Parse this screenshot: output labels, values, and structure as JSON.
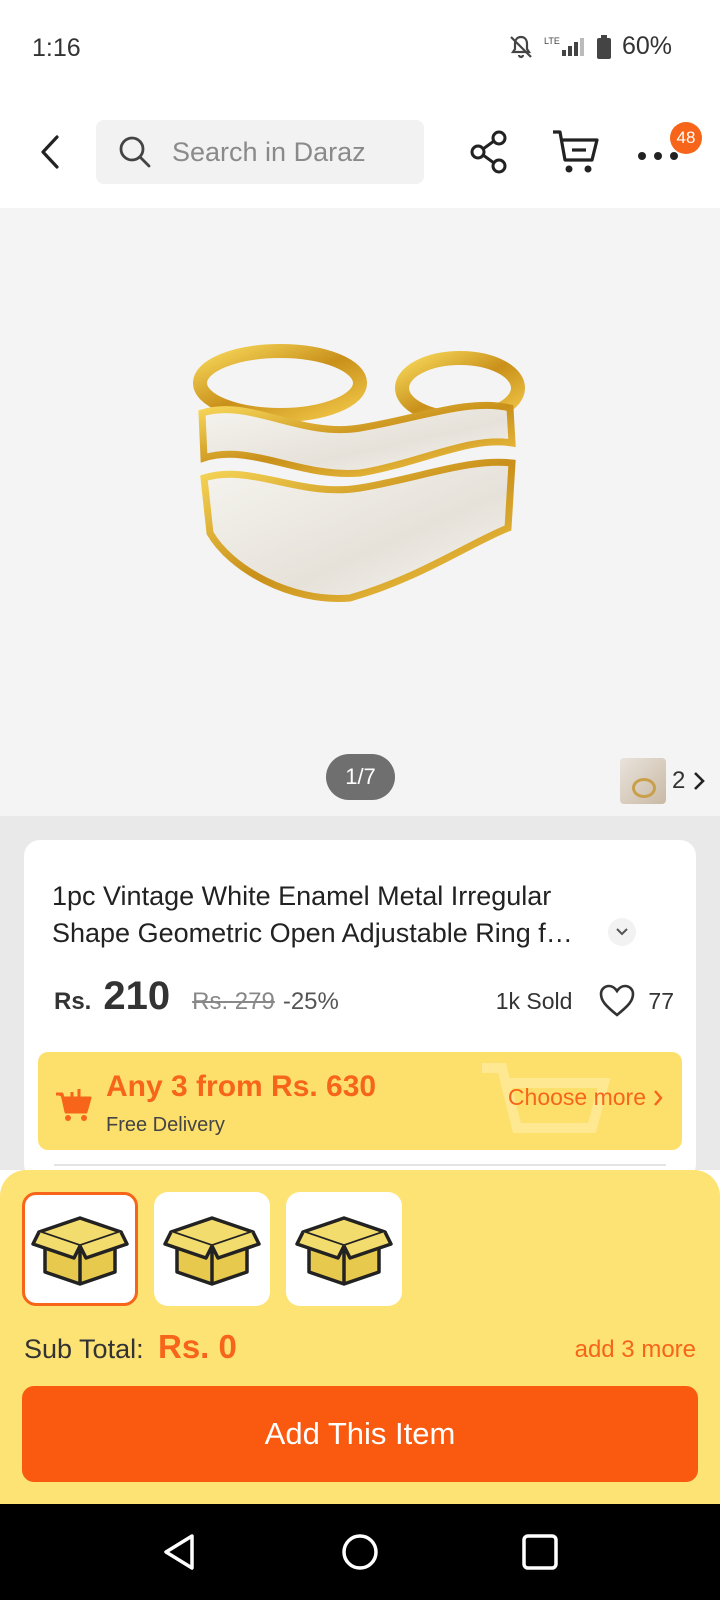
{
  "status_bar": {
    "time": "1:16",
    "network": "LTE",
    "battery": "60%"
  },
  "top_bar": {
    "search_placeholder": "Search in Daraz",
    "more_badge": "48"
  },
  "gallery": {
    "indicator": "1/7",
    "more_count": "2"
  },
  "product": {
    "title": "1pc Vintage White Enamel Metal Irregular Shape Geometric Open Adjustable Ring f…",
    "currency": "Rs.",
    "price": "210",
    "original_price": "Rs. 279",
    "discount": "-25%",
    "sold": "1k Sold",
    "wishlist_count": "77"
  },
  "promo": {
    "title": "Any 3 from Rs. 630",
    "subtitle": "Free Delivery",
    "link": "Choose more"
  },
  "bundle": {
    "subtotal_label": "Sub Total:",
    "subtotal_value": "Rs. 0",
    "add_more": "add 3 more",
    "add_button": "Add This Item"
  },
  "colors": {
    "accent": "#f6651a",
    "button": "#fa5a0f",
    "sheet": "#fde274",
    "banner": "#fddf6c"
  }
}
